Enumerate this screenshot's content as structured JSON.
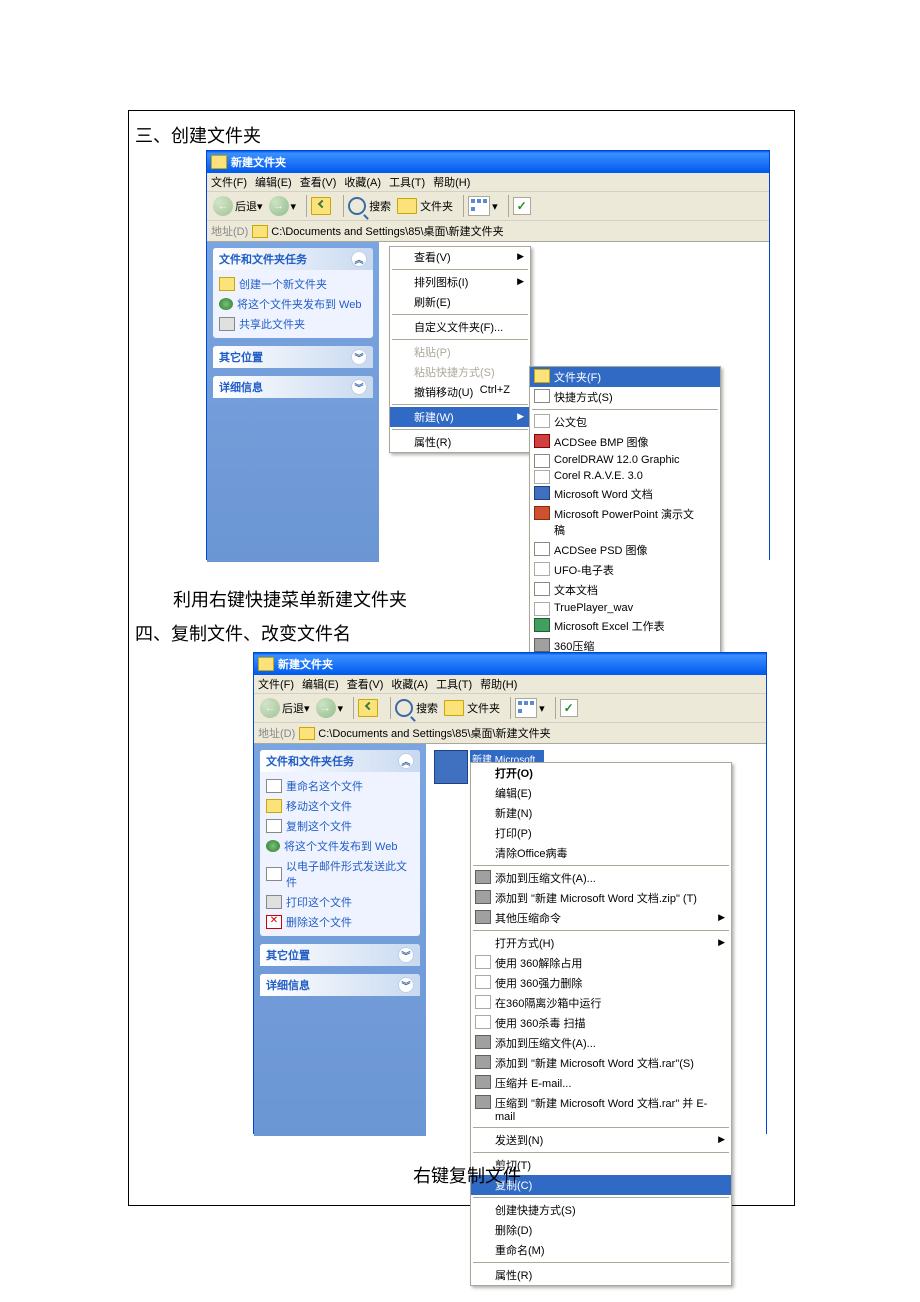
{
  "headings": {
    "h3": "三、创建文件夹",
    "cap1": "利用右键快捷菜单新建文件夹",
    "h4": "四、复制文件、改变文件名",
    "cap2": "右键复制文件"
  },
  "win1": {
    "title": "新建文件夹",
    "menu": {
      "file": "文件(F)",
      "edit": "编辑(E)",
      "view": "查看(V)",
      "fav": "收藏(A)",
      "tools": "工具(T)",
      "help": "帮助(H)"
    },
    "toolbar": {
      "back": "后退",
      "search": "搜索",
      "folders": "文件夹"
    },
    "addr": {
      "label": "地址(D)",
      "path": "C:\\Documents and Settings\\85\\桌面\\新建文件夹"
    },
    "panels": {
      "tasks": {
        "title": "文件和文件夹任务",
        "items": [
          "创建一个新文件夹",
          "将这个文件夹发布到 Web",
          "共享此文件夹"
        ]
      },
      "other": {
        "title": "其它位置"
      },
      "details": {
        "title": "详细信息"
      }
    },
    "ctx1": {
      "view": "查看(V)",
      "arrange": "排列图标(I)",
      "refresh": "刷新(E)",
      "custom": "自定义文件夹(F)...",
      "paste": "粘贴(P)",
      "pastesc": "粘贴快捷方式(S)",
      "undo": "撤销移动(U)",
      "undok": "Ctrl+Z",
      "new": "新建(W)",
      "prop": "属性(R)"
    },
    "submenu": [
      {
        "icon": "fld",
        "label": "文件夹(F)",
        "sel": true
      },
      {
        "icon": "lnk",
        "label": "快捷方式(S)"
      },
      {
        "sep": true
      },
      {
        "icon": "gen",
        "label": "公文包"
      },
      {
        "icon": "bmp",
        "label": "ACDSee BMP 图像"
      },
      {
        "icon": "cdr",
        "label": "CorelDRAW 12.0 Graphic"
      },
      {
        "icon": "gen",
        "label": "Corel R.A.V.E. 3.0"
      },
      {
        "icon": "doc",
        "label": "Microsoft Word 文档"
      },
      {
        "icon": "ppt",
        "label": "Microsoft PowerPoint 演示文稿"
      },
      {
        "icon": "psd",
        "label": "ACDSee PSD 图像"
      },
      {
        "icon": "gen",
        "label": "UFO-电子表"
      },
      {
        "icon": "txt",
        "label": "文本文档"
      },
      {
        "icon": "gen",
        "label": "TruePlayer_wav"
      },
      {
        "icon": "xls",
        "label": "Microsoft Excel 工作表"
      },
      {
        "icon": "zip",
        "label": "360压缩"
      }
    ]
  },
  "win2": {
    "title": "新建文件夹",
    "menu": {
      "file": "文件(F)",
      "edit": "编辑(E)",
      "view": "查看(V)",
      "fav": "收藏(A)",
      "tools": "工具(T)",
      "help": "帮助(H)"
    },
    "toolbar": {
      "back": "后退",
      "search": "搜索",
      "folders": "文件夹"
    },
    "addr": {
      "label": "地址(D)",
      "path": "C:\\Documents and Settings\\85\\桌面\\新建文件夹"
    },
    "panels": {
      "tasks": {
        "title": "文件和文件夹任务",
        "items": [
          "重命名这个文件",
          "移动这个文件",
          "复制这个文件",
          "将这个文件发布到 Web",
          "以电子邮件形式发送此文件",
          "打印这个文件",
          "删除这个文件"
        ]
      },
      "other": {
        "title": "其它位置"
      },
      "details": {
        "title": "详细信息"
      }
    },
    "file": {
      "name": "新建 Microsoft Word"
    },
    "ctx": [
      {
        "label": "打开(O)",
        "b": true
      },
      {
        "label": "编辑(E)"
      },
      {
        "label": "新建(N)"
      },
      {
        "label": "打印(P)"
      },
      {
        "label": "清除Office病毒"
      },
      {
        "sep": true
      },
      {
        "icon": "zip",
        "label": "添加到压缩文件(A)..."
      },
      {
        "icon": "zip",
        "label": "添加到 \"新建 Microsoft Word 文档.zip\" (T)"
      },
      {
        "icon": "zip",
        "label": "其他压缩命令",
        "arr": true
      },
      {
        "sep": true
      },
      {
        "label": "打开方式(H)",
        "arr": true
      },
      {
        "icon": "gen",
        "label": "使用 360解除占用"
      },
      {
        "icon": "gen",
        "label": "使用 360强力删除"
      },
      {
        "icon": "gen",
        "label": "在360隔离沙箱中运行"
      },
      {
        "icon": "gen",
        "label": "使用 360杀毒 扫描"
      },
      {
        "icon": "zip",
        "label": "添加到压缩文件(A)..."
      },
      {
        "icon": "zip",
        "label": "添加到 \"新建 Microsoft Word 文档.rar\"(S)"
      },
      {
        "icon": "zip",
        "label": "压缩并 E-mail..."
      },
      {
        "icon": "zip",
        "label": "压缩到 \"新建 Microsoft Word 文档.rar\" 并 E-mail"
      },
      {
        "sep": true
      },
      {
        "label": "发送到(N)",
        "arr": true
      },
      {
        "sep": true
      },
      {
        "label": "剪切(T)"
      },
      {
        "label": "复制(C)",
        "sel": true
      },
      {
        "sep": true
      },
      {
        "label": "创建快捷方式(S)"
      },
      {
        "label": "删除(D)"
      },
      {
        "label": "重命名(M)"
      },
      {
        "sep": true
      },
      {
        "label": "属性(R)"
      }
    ]
  }
}
